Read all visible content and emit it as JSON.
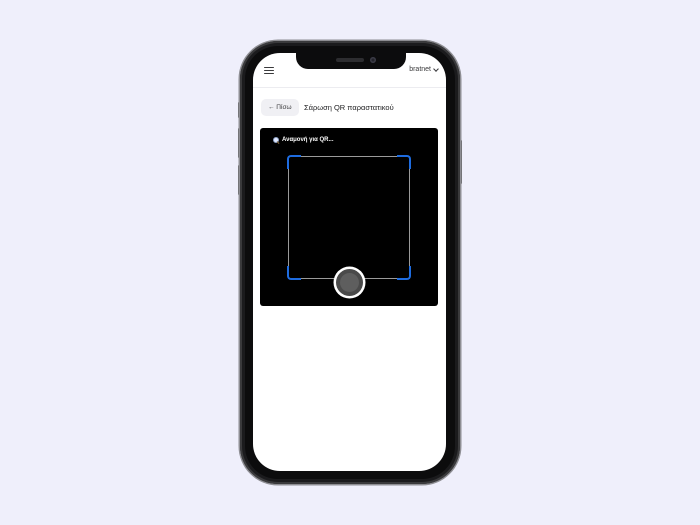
{
  "topbar": {
    "menu_icon": "hamburger-menu-icon",
    "account_label": "bratnet",
    "account_icon": "chevron-down-icon"
  },
  "header": {
    "back_label": "← Πίσω",
    "title": "Σάρωση QR παραστατικού"
  },
  "scanner": {
    "status_icon": "magnifier-icon",
    "status_text": "Αναμονή για QR...",
    "frame_corner_color": "#1e6ce0",
    "shutter_icon": "shutter-button-icon"
  },
  "colors": {
    "page_background": "#efeffb",
    "scanner_background": "#000000",
    "accent": "#1e6ce0"
  }
}
